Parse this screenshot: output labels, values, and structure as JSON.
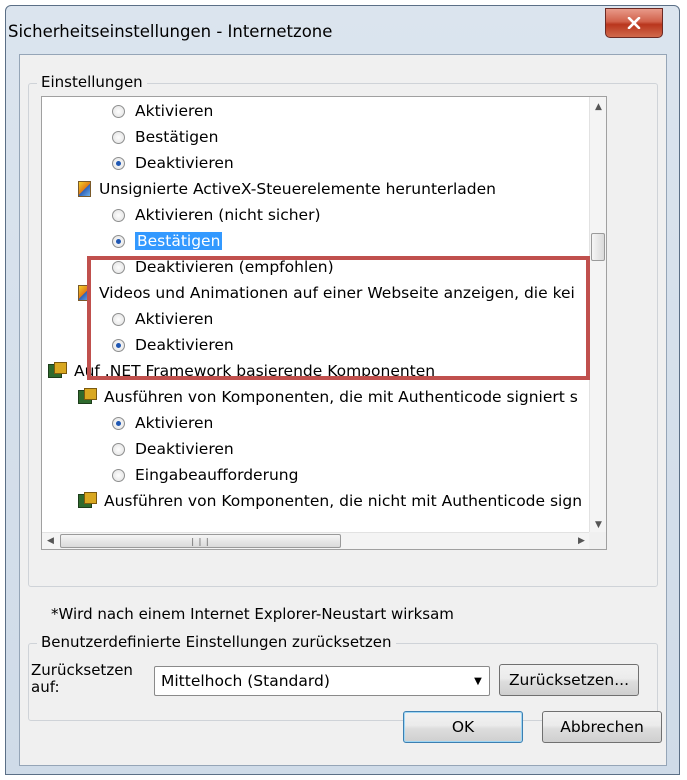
{
  "window": {
    "title": "Sicherheitseinstellungen - Internetzone"
  },
  "settings": {
    "group_label": "Einstellungen",
    "items": [
      {
        "kind": "radio",
        "label": "Aktivieren",
        "checked": false,
        "indent": 2
      },
      {
        "kind": "radio",
        "label": "Bestätigen",
        "checked": false,
        "indent": 2
      },
      {
        "kind": "radio",
        "label": "Deaktivieren",
        "checked": true,
        "indent": 2
      },
      {
        "kind": "header",
        "icon": "activex-icon",
        "label": "Unsignierte ActiveX-Steuerelemente herunterladen",
        "indent": 1
      },
      {
        "kind": "radio",
        "label": "Aktivieren (nicht sicher)",
        "checked": false,
        "indent": 2
      },
      {
        "kind": "radio",
        "label": "Bestätigen",
        "checked": true,
        "selected": true,
        "indent": 2
      },
      {
        "kind": "radio",
        "label": "Deaktivieren (empfohlen)",
        "checked": false,
        "indent": 2
      },
      {
        "kind": "header",
        "icon": "activex-icon",
        "label": "Videos und Animationen auf einer Webseite anzeigen, die kei",
        "indent": 1
      },
      {
        "kind": "radio",
        "label": "Aktivieren",
        "checked": false,
        "indent": 2
      },
      {
        "kind": "radio",
        "label": "Deaktivieren",
        "checked": true,
        "indent": 2
      },
      {
        "kind": "header",
        "icon": "dotnet-icon",
        "label": "Auf .NET Framework basierende Komponenten",
        "indent": 0
      },
      {
        "kind": "header",
        "icon": "dotnet-icon",
        "label": "Ausführen von Komponenten, die mit Authenticode signiert s",
        "indent": 1
      },
      {
        "kind": "radio",
        "label": "Aktivieren",
        "checked": true,
        "indent": 2
      },
      {
        "kind": "radio",
        "label": "Deaktivieren",
        "checked": false,
        "indent": 2
      },
      {
        "kind": "radio",
        "label": "Eingabeaufforderung",
        "checked": false,
        "indent": 2
      },
      {
        "kind": "header",
        "icon": "dotnet-icon",
        "label": "Ausführen von Komponenten, die nicht mit Authenticode sign",
        "indent": 1
      }
    ]
  },
  "restart_note": "*Wird nach einem Internet Explorer-Neustart wirksam",
  "reset_group": {
    "label": "Benutzerdefinierte Einstellungen zurücksetzen",
    "reset_to_label": "Zurücksetzen auf:",
    "selected_level": "Mittelhoch (Standard)",
    "reset_button": "Zurücksetzen..."
  },
  "buttons": {
    "ok": "OK",
    "cancel": "Abbrechen"
  }
}
